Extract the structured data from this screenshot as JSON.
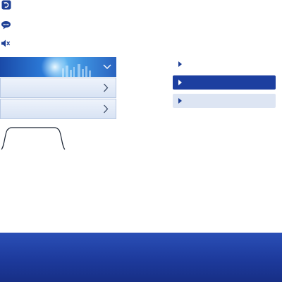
{
  "colors": {
    "accent": "#1c3fa0",
    "accent_light": "#dde5f3",
    "icon_blue": "#1d3f95",
    "bottom_bar": "#1d3a9c"
  },
  "icons": {
    "top_icon_1": "undo-icon",
    "top_icon_2": "chat-bubble-icon",
    "top_icon_3": "mute-speaker-icon"
  },
  "accordion": {
    "header_icon": "chevron-down-icon",
    "rows": [
      {
        "icon": "chevron-right-icon"
      },
      {
        "icon": "chevron-right-icon"
      }
    ]
  },
  "right_list": {
    "items": [
      {
        "state": "plain",
        "icon": "play-triangle-icon"
      },
      {
        "state": "selected",
        "icon": "play-triangle-icon"
      },
      {
        "state": "hover",
        "icon": "play-triangle-icon"
      }
    ]
  }
}
